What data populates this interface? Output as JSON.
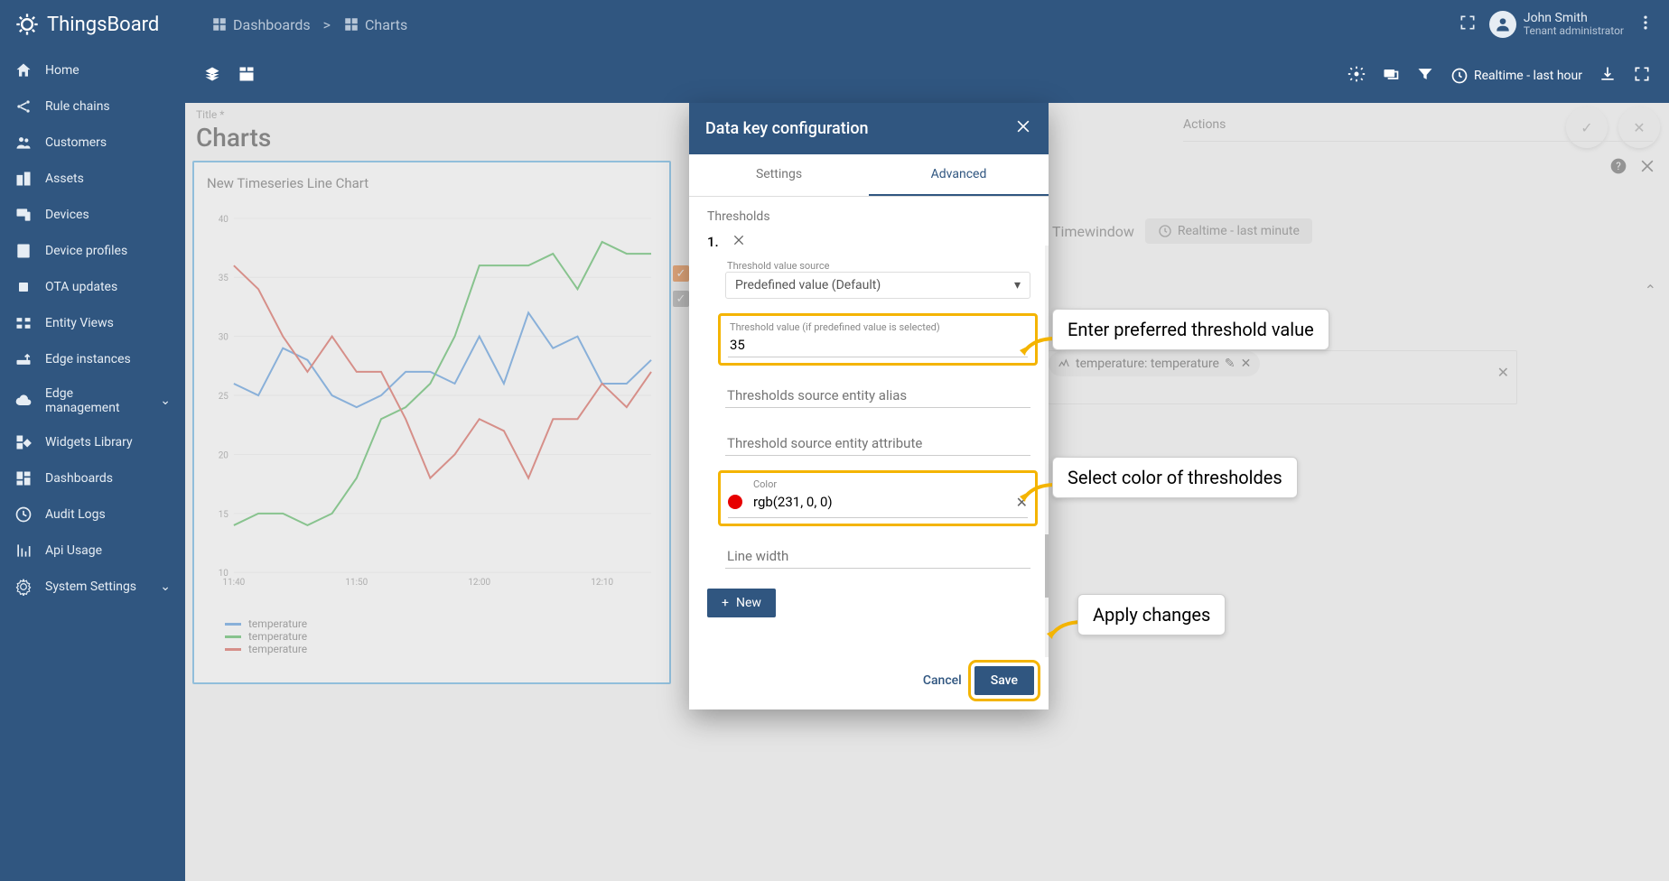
{
  "app": {
    "name": "ThingsBoard"
  },
  "breadcrumb": {
    "parent": "Dashboards",
    "separator": ">",
    "current": "Charts"
  },
  "user": {
    "name": "John Smith",
    "role": "Tenant administrator"
  },
  "sidebar": {
    "items": [
      {
        "label": "Home"
      },
      {
        "label": "Rule chains"
      },
      {
        "label": "Customers"
      },
      {
        "label": "Assets"
      },
      {
        "label": "Devices"
      },
      {
        "label": "Device profiles"
      },
      {
        "label": "OTA updates"
      },
      {
        "label": "Entity Views"
      },
      {
        "label": "Edge instances"
      },
      {
        "label": "Edge management",
        "expandable": true
      },
      {
        "label": "Widgets Library"
      },
      {
        "label": "Dashboards"
      },
      {
        "label": "Audit Logs"
      },
      {
        "label": "Api Usage"
      },
      {
        "label": "System Settings",
        "expandable": true
      }
    ]
  },
  "toolbar": {
    "time_label": "Realtime - last hour"
  },
  "page": {
    "title_label": "Title *",
    "title": "Charts"
  },
  "widget": {
    "title": "New Timeseries Line Chart",
    "tabs": {
      "actions": "Actions"
    },
    "timewindow_label": "Timewindow",
    "timewindow_value": "Realtime - last minute",
    "series_chip": {
      "key": "temperature",
      "label": "temperature"
    }
  },
  "legend": {
    "items": [
      "temperature",
      "temperature",
      "temperature"
    ],
    "colors": [
      "#3e8bdc",
      "#3cb14a",
      "#d84b3f"
    ]
  },
  "dialog": {
    "title": "Data key configuration",
    "tabs": {
      "settings": "Settings",
      "advanced": "Advanced"
    },
    "section": "Thresholds",
    "thresh_idx": "1.",
    "value_source_label": "Threshold value source",
    "value_source": "Predefined value (Default)",
    "value_label": "Threshold value (if predefined value is selected)",
    "value": "35",
    "alias_label": "Thresholds source entity alias",
    "attr_label": "Threshold source entity attribute",
    "color_label": "Color",
    "color_value": "rgb(231, 0, 0)",
    "linewidth_label": "Line width",
    "new_btn": "New",
    "cancel": "Cancel",
    "save": "Save"
  },
  "callouts": {
    "threshold": "Enter preferred threshold value",
    "color": "Select color of thresholdes",
    "apply": "Apply changes"
  },
  "chart_data": {
    "type": "line",
    "title": "New Timeseries Line Chart",
    "ylabel": "",
    "xlabel": "",
    "ylim": [
      10,
      40
    ],
    "x": [
      "11:40",
      "11:42",
      "11:44",
      "11:46",
      "11:48",
      "11:50",
      "11:52",
      "11:54",
      "11:56",
      "11:58",
      "12:00",
      "12:02",
      "12:04",
      "12:06",
      "12:08",
      "12:10",
      "12:12",
      "12:14"
    ],
    "xticks": [
      "11:40",
      "11:50",
      "12:00",
      "12:10"
    ],
    "yticks": [
      10,
      15,
      20,
      25,
      30,
      35,
      40
    ],
    "series": [
      {
        "name": "temperature",
        "color": "#3e8bdc",
        "values": [
          26,
          25,
          29,
          28,
          25,
          24,
          25,
          27,
          27,
          26,
          30,
          26,
          32,
          29,
          30,
          26,
          26,
          28
        ]
      },
      {
        "name": "temperature",
        "color": "#3cb14a",
        "values": [
          14,
          15,
          15,
          14,
          15,
          18,
          23,
          24,
          26,
          30,
          36,
          36,
          36,
          37,
          34,
          38,
          37,
          37
        ]
      },
      {
        "name": "temperature",
        "color": "#d84b3f",
        "values": [
          36,
          34,
          30,
          27,
          30,
          27,
          27,
          23,
          18,
          20,
          23,
          22,
          18,
          23,
          23,
          26,
          24,
          27
        ]
      }
    ]
  }
}
